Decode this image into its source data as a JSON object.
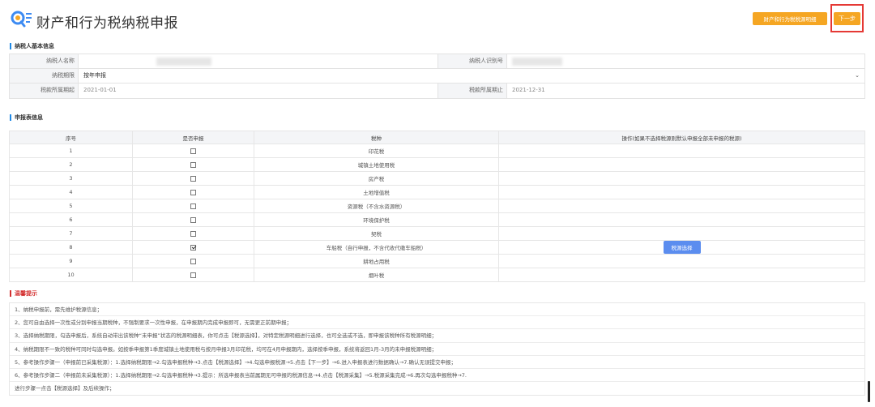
{
  "header": {
    "title": "财产和行为税纳税申报",
    "detail_button": "财产和行为税税源明细",
    "next_button": "下一步"
  },
  "basic_info": {
    "section_title": "纳税人基本信息",
    "taxpayer_name_label": "纳税人名称",
    "taxpayer_id_label": "纳税人识别号",
    "period_label": "纳税期限",
    "period_value": "按年申报",
    "start_label": "税款所属期起",
    "start_value": "2021-01-01",
    "end_label": "税款所属期止",
    "end_value": "2021-12-31"
  },
  "declaration": {
    "section_title": "申报表信息",
    "headers": [
      "序号",
      "是否申报",
      "税种",
      "操作(如果不选择税源则默认申报全部未申报的税源)"
    ],
    "rows": [
      {
        "no": "1",
        "checked": false,
        "tax": "印花税"
      },
      {
        "no": "2",
        "checked": false,
        "tax": "城镇土地使用税"
      },
      {
        "no": "3",
        "checked": false,
        "tax": "房产税"
      },
      {
        "no": "4",
        "checked": false,
        "tax": "土地增值税"
      },
      {
        "no": "5",
        "checked": false,
        "tax": "资源税（不含水资源税）"
      },
      {
        "no": "6",
        "checked": false,
        "tax": "环境保护税"
      },
      {
        "no": "7",
        "checked": false,
        "tax": "契税"
      },
      {
        "no": "8",
        "checked": true,
        "tax": "车船税（自行申报，不含代收代缴车船税）",
        "action": "税源选择"
      },
      {
        "no": "9",
        "checked": false,
        "tax": "耕地占用税"
      },
      {
        "no": "10",
        "checked": false,
        "tax": "烟叶税"
      }
    ]
  },
  "tips": {
    "section_title": "温馨提示",
    "items": [
      "1、纳税申报前，需先维护税源信息；",
      "2、您可自由选择一次性或分别申报当期税种，不强制要求一次性申报，在申报期内完成申报即可，无需更正前期申报；",
      "3、选择纳税期限，勾选申报后，系统自动带出该税种“未申报”状态的税源明细表，你可点击【税源选择】，对特定税源明细进行选择，也可全选或不选，即申报该税种所有税源明细；",
      "4、纳税期限不一致的税种可同时勾选申报。如按季申报第1季度城镇土地使用税与按月申报3月印花税，均可在4月申报期内，选择按季申报，系统将返回1月-3月的未申报税源明细；",
      "5、参考操作步骤一（申报前已采集税源）：1.选择纳税期限→2.勾选申报税种→3.点击【税源选择】→4.勾选申报税源→5.点击【下一步】→6.进入申报表进行数据确认→7.确认无误提交申报；",
      "6、参考操作步骤二（申报前未采集税源）：1.选择纳税期限→2.勾选申报税种→3.提示：所选申报表当前属期无可申报的税源信息→4.点击【税源采集】→5.税源采集完成→6.再次勾选申报税种→7.",
      "进行步骤一点击【税源选择】及后续操作；"
    ]
  },
  "colors": {
    "accent_orange": "#f5a623",
    "accent_blue": "#5b8def",
    "highlight_red": "#e53935",
    "section_blue": "#1e88e5"
  }
}
